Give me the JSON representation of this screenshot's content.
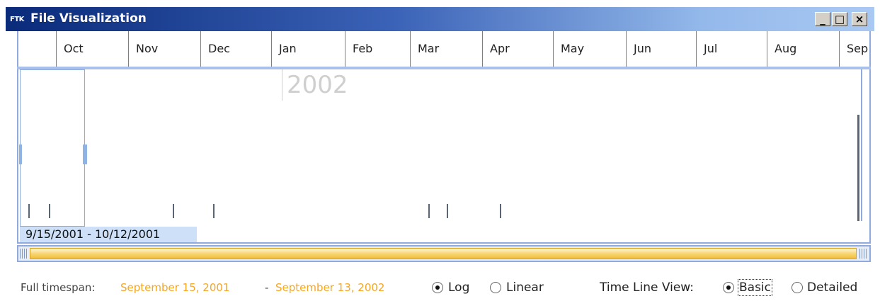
{
  "window": {
    "app_icon_text": "FTK",
    "title": "File Visualization",
    "buttons": {
      "minimize": "_",
      "maximize": "□",
      "close": "×"
    }
  },
  "timeline": {
    "months": [
      "",
      "Oct",
      "Nov",
      "Dec",
      "Jan",
      "Feb",
      "Mar",
      "Apr",
      "May",
      "Jun",
      "Jul",
      "Aug",
      "Sep"
    ],
    "year_marker": "2002",
    "selection_range": "9/15/2001 - 10/12/2001"
  },
  "footer": {
    "full_timespan_label": "Full timespan:",
    "full_timespan_start": "September 15, 2001",
    "full_timespan_separator": "-",
    "full_timespan_end": "September 13, 2002",
    "scale_options": [
      {
        "label": "Log",
        "checked": true
      },
      {
        "label": "Linear",
        "checked": false
      }
    ],
    "time_line_view_label": "Time Line View:",
    "view_options": [
      {
        "label": "Basic",
        "checked": true
      },
      {
        "label": "Detailed",
        "checked": false
      }
    ]
  },
  "colors": {
    "accent_orange": "#f5a623",
    "border_blue": "#8faadc",
    "title_dark": "#0a2a7a"
  }
}
